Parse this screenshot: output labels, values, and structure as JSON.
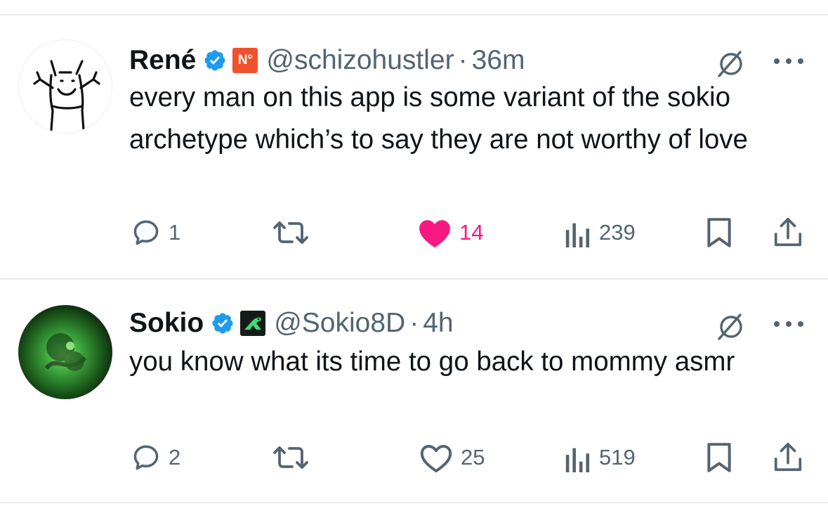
{
  "tweets": [
    {
      "name": "René",
      "handle": "@schizohustler",
      "separator": "·",
      "time": "36m",
      "affiliate_badge_text": "N°",
      "text": "every man on this app is some variant of the sokio archetype which’s to say they are not worthy of love",
      "liked": true,
      "replies": "1",
      "likes": "14",
      "views": "239"
    },
    {
      "name": "Sokio",
      "handle": "@Sokio8D",
      "separator": "·",
      "time": "4h",
      "affiliate_badge_text": "",
      "text": "you know what its time to go back to mommy asmr",
      "liked": false,
      "replies": "2",
      "likes": "25",
      "views": "519"
    }
  ],
  "icons": {
    "verified": "verified-badge-icon",
    "grok": "grok-icon",
    "more": "more-icon",
    "reply": "reply-icon",
    "retweet": "retweet-icon",
    "like": "like-icon",
    "views": "views-icon",
    "bookmark": "bookmark-icon",
    "share": "share-icon"
  },
  "colors": {
    "verified_blue": "#1d9bf0",
    "like_pink": "#f91880",
    "muted_gray": "#536471",
    "text_black": "#0f1419",
    "affiliate_orange": "#f0522d",
    "affiliate_green_bg": "#151c18",
    "affiliate_green": "#3fd67a"
  }
}
